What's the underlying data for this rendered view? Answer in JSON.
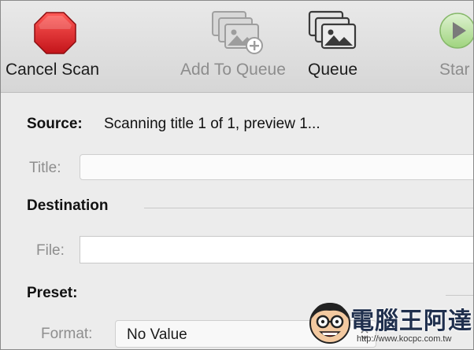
{
  "toolbar": {
    "cancel_scan": "Cancel Scan",
    "add_to_queue": "Add To Queue",
    "queue": "Queue",
    "start": "Star"
  },
  "source": {
    "label": "Source:",
    "value": "Scanning title 1 of 1, preview 1..."
  },
  "title": {
    "label": "Title:",
    "value": ""
  },
  "destination": {
    "label": "Destination",
    "file_label": "File:",
    "file_value": ""
  },
  "preset": {
    "label": "Preset:"
  },
  "format": {
    "label": "Format:",
    "value": "No Value"
  },
  "watermark": {
    "name": "電腦王阿達",
    "url": "http://www.kocpc.com.tw"
  },
  "colors": {
    "stop_red": "#e0242b",
    "start_green": "#8dcf6a",
    "icon_dark": "#3a3a3a",
    "icon_disabled": "#9a9a9a"
  }
}
